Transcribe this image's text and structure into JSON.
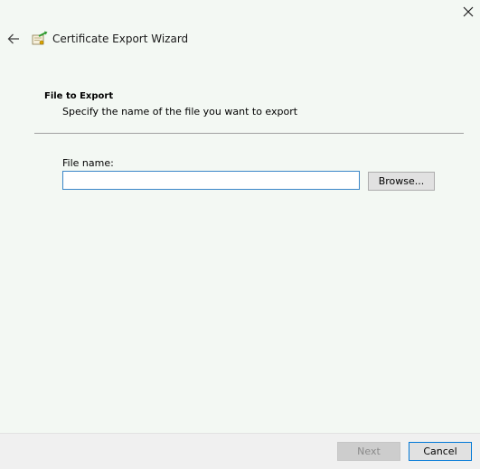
{
  "window": {
    "title": "Certificate Export Wizard",
    "background": "#f3f8f3",
    "icons": {
      "close": "close-icon",
      "back": "back-arrow-icon",
      "title": "certificate-icon"
    }
  },
  "section": {
    "heading": "File to Export",
    "description": "Specify the name of the file you want to export"
  },
  "file_name": {
    "label": "File name:",
    "value": "",
    "browse_label": "Browse..."
  },
  "footer": {
    "next_label": "Next",
    "next_enabled": false,
    "cancel_label": "Cancel"
  }
}
